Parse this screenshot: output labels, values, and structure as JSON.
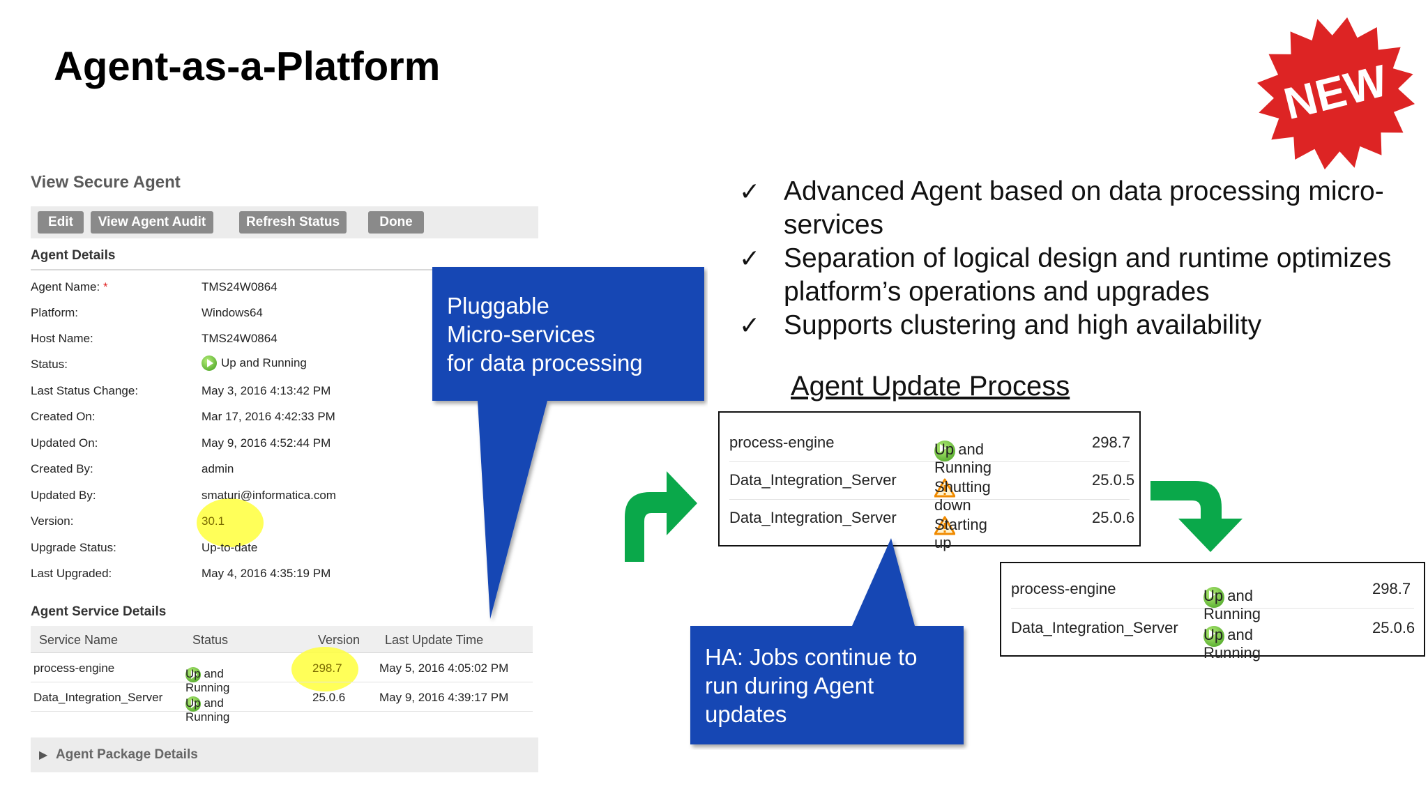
{
  "slide": {
    "title": "Agent-as-a-Platform",
    "badge": "NEW"
  },
  "agent_panel": {
    "title": "View Secure Agent",
    "buttons": [
      "Edit",
      "View Agent Audit",
      "Refresh Status",
      "Done"
    ],
    "details_title": "Agent Details",
    "details": [
      {
        "label": "Agent Name:",
        "required": "*",
        "value": "TMS24W0864"
      },
      {
        "label": "Platform:",
        "value": "Windows64"
      },
      {
        "label": "Host Name:",
        "value": "TMS24W0864"
      },
      {
        "label": "Status:",
        "value": "Up and Running",
        "icon": "running-icon"
      },
      {
        "label": "Last Status Change:",
        "value": "May 3, 2016 4:13:42 PM"
      },
      {
        "label": "Created On:",
        "value": "Mar 17, 2016 4:42:33 PM"
      },
      {
        "label": "Updated On:",
        "value": "May 9, 2016 4:52:44 PM"
      },
      {
        "label": "Created By:",
        "value": "admin"
      },
      {
        "label": "Updated By:",
        "value": "smaturi@informatica.com"
      },
      {
        "label": "Version:",
        "value": "30.1"
      },
      {
        "label": "Upgrade Status:",
        "value": "Up-to-date"
      },
      {
        "label": "Last Upgraded:",
        "value": "May 4, 2016 4:35:19 PM"
      }
    ],
    "service_title": "Agent Service Details",
    "service_columns": [
      "Service Name",
      "Status",
      "Version",
      "Last Update Time"
    ],
    "services": [
      {
        "name": "process-engine",
        "status": "Up and Running",
        "version": "298.7",
        "updated": "May 5, 2016 4:05:02 PM"
      },
      {
        "name": "Data_Integration_Server",
        "status": "Up and Running",
        "version": "25.0.6",
        "updated": "May 9, 2016 4:39:17 PM"
      }
    ],
    "package_label": "Agent Package Details"
  },
  "callouts": {
    "pluggable": [
      "Pluggable",
      "Micro-services",
      "for data processing"
    ],
    "ha": [
      "HA: Jobs continue to",
      "run during Agent",
      "updates"
    ]
  },
  "bullets": [
    [
      "Advanced Agent based on data processing micro-",
      "services"
    ],
    [
      "Separation of logical design and runtime optimizes",
      "platform’s operations and upgrades"
    ],
    [
      "Supports clustering and high availability"
    ]
  ],
  "bullet_mark": "✓",
  "update_process": {
    "title": "Agent Update Process",
    "before": [
      {
        "name": "process-engine",
        "status": "Up and Running",
        "state": "ok",
        "version": "298.7"
      },
      {
        "name": "Data_Integration_Server",
        "status": "Shutting down",
        "state": "warn",
        "version": "25.0.5"
      },
      {
        "name": "Data_Integration_Server",
        "status": "Starting up",
        "state": "warn",
        "version": "25.0.6"
      }
    ],
    "after": [
      {
        "name": "process-engine",
        "status": "Up and Running",
        "state": "ok",
        "version": "298.7"
      },
      {
        "name": "Data_Integration_Server",
        "status": "Up and Running",
        "state": "ok",
        "version": "25.0.6"
      }
    ]
  },
  "colors": {
    "callout_blue": "#1446b4",
    "arrow_green": "#0aa84a",
    "badge_red": "#dd2424",
    "highlight": "#ffff3c"
  }
}
